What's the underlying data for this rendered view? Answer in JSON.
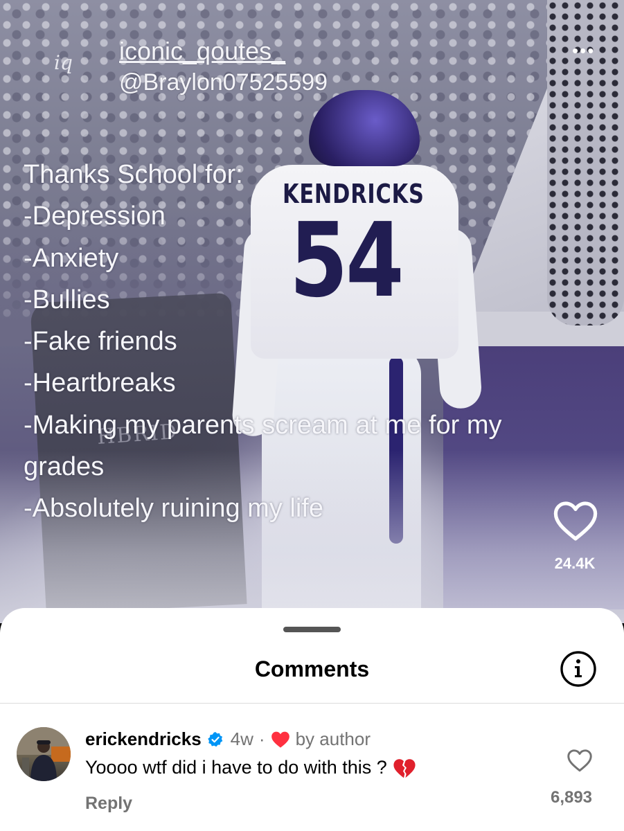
{
  "post": {
    "logo_text": "iq",
    "username": "iconic_qoutes_",
    "handle": "@Braylon07525599",
    "more_icon": "•••",
    "caption_lines": [
      "Thanks School for:",
      "-Depression",
      "-Anxiety",
      "-Bullies",
      "-Fake friends",
      "-Heartbreaks",
      "-Making my parents scream at me for my",
      "grades",
      "-Absolutely ruining my life"
    ],
    "like_count": "24.4K",
    "photo": {
      "jersey_name": "KENDRICKS",
      "jersey_number": "54",
      "stone_text": "HBRID"
    }
  },
  "comments": {
    "title": "Comments",
    "items": [
      {
        "username": "erickendricks",
        "verified": true,
        "time": "4w",
        "separator": "·",
        "liked_by_author": "by author",
        "text": "Yoooo wtf did i have to do with this ?",
        "reply_label": "Reply",
        "like_count": "6,893"
      }
    ]
  },
  "colors": {
    "verified_blue": "#0095f6",
    "heart_red": "#ff3040",
    "secondary_text": "#737373"
  },
  "icons": {
    "like": "heart-outline-icon",
    "info": "info-circle-icon",
    "verified": "verified-badge-icon",
    "author_like": "red-heart-icon",
    "emoji": "broken-heart-icon"
  }
}
